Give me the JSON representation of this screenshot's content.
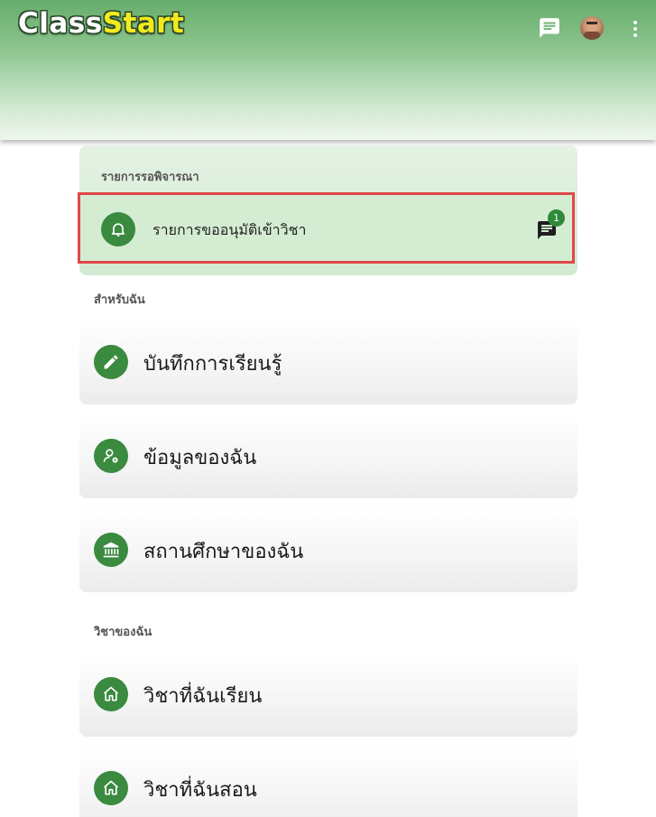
{
  "app": {
    "logo_part1": "Class",
    "logo_part2": "Start",
    "icons": {
      "chat": "chat-icon",
      "avatar": "user-avatar",
      "menu": "more-vert-icon"
    }
  },
  "pending": {
    "title": "รายการรอพิจารณา",
    "item_label": "รายการขออนุมัติเข้าวิชา",
    "badge_count": "1",
    "icon": "bell-icon"
  },
  "sections": {
    "for_me": "สำหรับฉัน",
    "my_courses": "วิชาของฉัน"
  },
  "for_me_items": [
    {
      "label": "บันทึกการเรียนรู้",
      "icon": "pencil-icon"
    },
    {
      "label": "ข้อมูลของฉัน",
      "icon": "user-settings-icon"
    },
    {
      "label": "สถานศึกษาของฉัน",
      "icon": "institution-icon"
    }
  ],
  "course_items": [
    {
      "label": "วิชาที่ฉันเรียน",
      "icon": "home-icon"
    },
    {
      "label": "วิชาที่ฉันสอน",
      "icon": "home-icon"
    }
  ],
  "colors": {
    "brand_green": "#3a8a3f",
    "highlight_red": "#e0484a",
    "logo_yellow": "#f2ea1c"
  }
}
